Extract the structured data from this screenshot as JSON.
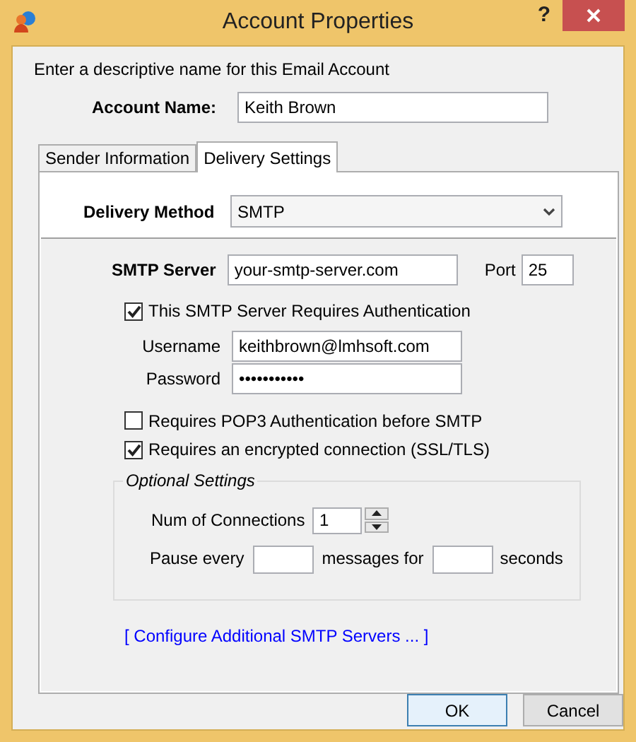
{
  "window": {
    "title": "Account Properties",
    "help_button": "?"
  },
  "intro": "Enter a descriptive name for this Email Account",
  "account_name": {
    "label": "Account Name:",
    "value": "Keith Brown"
  },
  "tabs": [
    {
      "label": "Sender Information",
      "selected": false
    },
    {
      "label": "Delivery Settings",
      "selected": true
    }
  ],
  "delivery_method": {
    "label": "Delivery Method",
    "value": "SMTP"
  },
  "smtp_server": {
    "label": "SMTP Server",
    "value": "your-smtp-server.com",
    "port_label": "Port",
    "port": "25"
  },
  "auth": {
    "label": "This SMTP Server Requires Authentication",
    "checked": true,
    "username_label": "Username",
    "username": "keithbrown@lmhsoft.com",
    "password_label": "Password",
    "password": "•••••••••••"
  },
  "options": [
    {
      "label": "Requires POP3 Authentication before SMTP",
      "checked": false
    },
    {
      "label": "Requires an encrypted connection (SSL/TLS)",
      "checked": true
    }
  ],
  "optional_settings": {
    "legend": "Optional Settings",
    "connections_label": "Num of Connections",
    "connections": "1",
    "pause_label": "Pause every",
    "messages_label": "messages for",
    "seconds_label": "seconds"
  },
  "link": "[ Configure Additional SMTP Servers ... ]",
  "buttons": [
    {
      "label": "OK",
      "default": true
    },
    {
      "label": "Cancel",
      "default": false
    }
  ]
}
